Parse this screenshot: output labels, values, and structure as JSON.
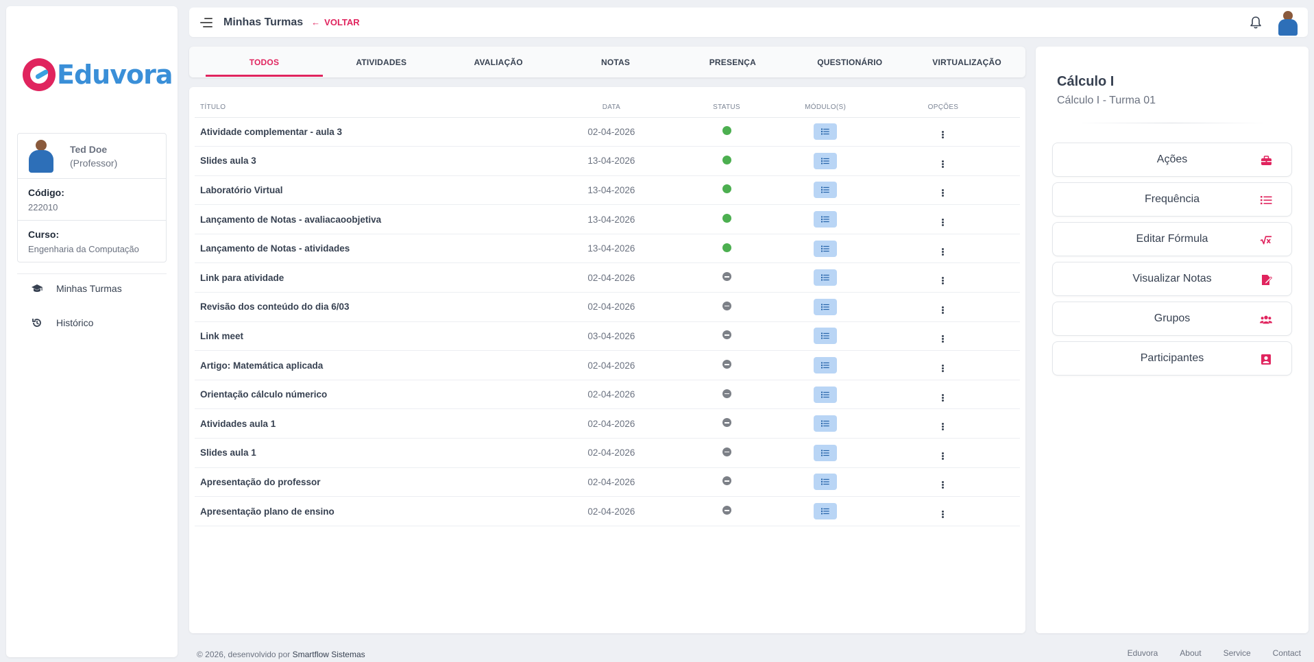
{
  "brand": {
    "name": "Eduvora",
    "mark_color": "#e0245e",
    "text_color": "#3a8fd8"
  },
  "profile": {
    "name": "Ted Doe",
    "role": "(Professor)",
    "code_label": "Código:",
    "code_value": "222010",
    "course_label": "Curso:",
    "course_value": "Engenharia da Computação"
  },
  "sidebar": {
    "items": [
      {
        "label": "Minhas Turmas",
        "icon": "graduation-cap-icon"
      },
      {
        "label": "Histórico",
        "icon": "history-icon"
      }
    ]
  },
  "header": {
    "title": "Minhas Turmas",
    "back_label": "VOLTAR",
    "accent": "#e0245e"
  },
  "tabs": [
    {
      "label": "TODOS",
      "active": true
    },
    {
      "label": "ATIVIDADES"
    },
    {
      "label": "AVALIAÇÃO"
    },
    {
      "label": "NOTAS"
    },
    {
      "label": "PRESENÇA"
    },
    {
      "label": "QUESTIONÁRIO"
    },
    {
      "label": "VIRTUALIZAÇÃO"
    }
  ],
  "table": {
    "columns": [
      "TÍTULO",
      "DATA",
      "STATUS",
      "MÓDULO(S)",
      "OPÇÕES"
    ],
    "rows": [
      {
        "title": "Atividade complementar - aula 3",
        "date": "02-04-2026",
        "status": "active"
      },
      {
        "title": "Slides aula 3",
        "date": "13-04-2026",
        "status": "active"
      },
      {
        "title": "Laboratório Virtual",
        "date": "13-04-2026",
        "status": "active"
      },
      {
        "title": "Lançamento de Notas - avaliacaoobjetiva",
        "date": "13-04-2026",
        "status": "active"
      },
      {
        "title": "Lançamento de Notas - atividades",
        "date": "13-04-2026",
        "status": "active"
      },
      {
        "title": "Link para atividade",
        "date": "02-04-2026",
        "status": "inactive"
      },
      {
        "title": "Revisão dos conteúdo do dia 6/03",
        "date": "02-04-2026",
        "status": "inactive"
      },
      {
        "title": "Link meet",
        "date": "03-04-2026",
        "status": "inactive"
      },
      {
        "title": "Artigo: Matemática aplicada",
        "date": "02-04-2026",
        "status": "inactive"
      },
      {
        "title": "Orientação cálculo númerico",
        "date": "02-04-2026",
        "status": "inactive"
      },
      {
        "title": "Atividades aula 1",
        "date": "02-04-2026",
        "status": "inactive"
      },
      {
        "title": "Slides aula 1",
        "date": "02-04-2026",
        "status": "inactive"
      },
      {
        "title": "Apresentação do professor",
        "date": "02-04-2026",
        "status": "inactive"
      },
      {
        "title": "Apresentação plano de ensino",
        "date": "02-04-2026",
        "status": "inactive"
      }
    ],
    "status_colors": {
      "active": "#4caf50",
      "inactive": "#7c8087"
    },
    "module_button_color": "#b9d5f5"
  },
  "course": {
    "title": "Cálculo I",
    "subtitle": "Cálculo I - Turma 01",
    "actions": [
      {
        "label": "Ações",
        "icon": "toolbox-icon"
      },
      {
        "label": "Frequência",
        "icon": "list-icon"
      },
      {
        "label": "Editar Fórmula",
        "icon": "square-root-icon"
      },
      {
        "label": "Visualizar Notas",
        "icon": "edit-file-icon"
      },
      {
        "label": "Grupos",
        "icon": "users-icon"
      },
      {
        "label": "Participantes",
        "icon": "id-badge-icon"
      }
    ]
  },
  "footer": {
    "copyright": "© 2026, desenvolvido por ",
    "company": "Smartflow Sistemas",
    "links": [
      "Eduvora",
      "About",
      "Service",
      "Contact"
    ]
  }
}
